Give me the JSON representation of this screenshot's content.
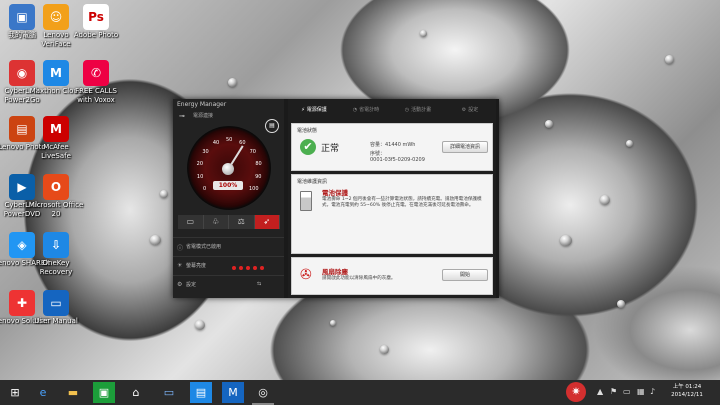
{
  "desktop_icons": [
    {
      "name": "computer",
      "label": "我的電腦",
      "glyph": "▣",
      "color": "#3a77c8"
    },
    {
      "name": "lenovo-veriface",
      "label": "Lenovo VeriFace",
      "glyph": "☺",
      "color": "#f2a01a"
    },
    {
      "name": "adobe-photoshop",
      "label": "Adobe Photo",
      "glyph": "Ps",
      "color": "#ffffff"
    },
    {
      "name": "cyberlink-power2go",
      "label": "CyberLink Power2Go",
      "glyph": "◉",
      "color": "#d33"
    },
    {
      "name": "maxthon-cloud",
      "label": "Maxthon Cloud",
      "glyph": "M",
      "color": "#1e88e5"
    },
    {
      "name": "free-calls",
      "label": "FREE CALLS with Voxox",
      "glyph": "✆",
      "color": "#e04"
    },
    {
      "name": "lenovo-photo",
      "label": "Lenovo Photo",
      "glyph": "▤",
      "color": "#c41"
    },
    {
      "name": "mcafee",
      "label": "McAfee LiveSafe",
      "glyph": "M",
      "color": "#c00"
    },
    {
      "name": "cyberlink-powerdvd",
      "label": "CyberLink PowerDVD",
      "glyph": "▶",
      "color": "#0a5fa8"
    },
    {
      "name": "office",
      "label": "Microsoft Office 20",
      "glyph": "O",
      "color": "#e64a19"
    },
    {
      "name": "lenovo-share",
      "label": "Lenovo SHAREit",
      "glyph": "◈",
      "color": "#2196f3"
    },
    {
      "name": "onekey-recovery",
      "label": "OneKey Recovery",
      "glyph": "⇩",
      "color": "#1e88e5"
    },
    {
      "name": "lenovo-solution",
      "label": "Lenovo Solution",
      "glyph": "✚",
      "color": "#e33"
    },
    {
      "name": "user-manual",
      "label": "User Manual",
      "glyph": "▭",
      "color": "#1565c0"
    }
  ],
  "energy_manager": {
    "title": "Energy Manager",
    "minimize": "–",
    "close": "✕",
    "plug_label": "電源連接",
    "gauge": {
      "percent_label": "100%",
      "percent": 100,
      "ticks": [
        "0",
        "10",
        "20",
        "30",
        "40",
        "50",
        "60",
        "70",
        "80",
        "90",
        "100"
      ]
    },
    "modes": [
      "電池",
      "省電",
      "平衡",
      "效能"
    ],
    "left_rows": [
      {
        "icon": "⚙",
        "text": "省電模式已啟用"
      },
      {
        "icon": "☀",
        "text": "螢幕亮度",
        "dots": 5
      },
      {
        "icon": "⚙",
        "text": "設定",
        "extra": "⇆"
      }
    ],
    "tabs": [
      {
        "icon": "⚡",
        "label": "電源保護"
      },
      {
        "icon": "◔",
        "label": "省電計時"
      },
      {
        "icon": "◷",
        "label": "活動計畫"
      },
      {
        "icon": "⚙",
        "label": "設定"
      }
    ],
    "battery_status": {
      "heading": "電池狀態",
      "state": "正常",
      "capacity": "容量：41440 mWh",
      "serial_label": "序號：",
      "serial": "0001-03f5-0209-0209",
      "button": "詳細電池資訊"
    },
    "battery_tip": {
      "heading": "電池維護資訊",
      "title": "電池保護",
      "text": "電池壽命 1~2 個月後會有一些計算電池狀態，請持續充電。請啟用電池保護模式，電池充電到約 55~60% 後停止充電。在電池充滿後可延長電池壽命。",
      "pages": 6,
      "active_page": 0
    },
    "cooling": {
      "title": "風扇除塵",
      "text": "請開啟此功能以清除風扇中的灰塵。",
      "button": "開始"
    }
  },
  "taskbar": {
    "items": [
      "start",
      "ie",
      "explorer",
      "store",
      "home",
      "network",
      "display",
      "maxthon",
      "energy"
    ],
    "time": "上午 01:24",
    "date": "2014/12/11"
  }
}
